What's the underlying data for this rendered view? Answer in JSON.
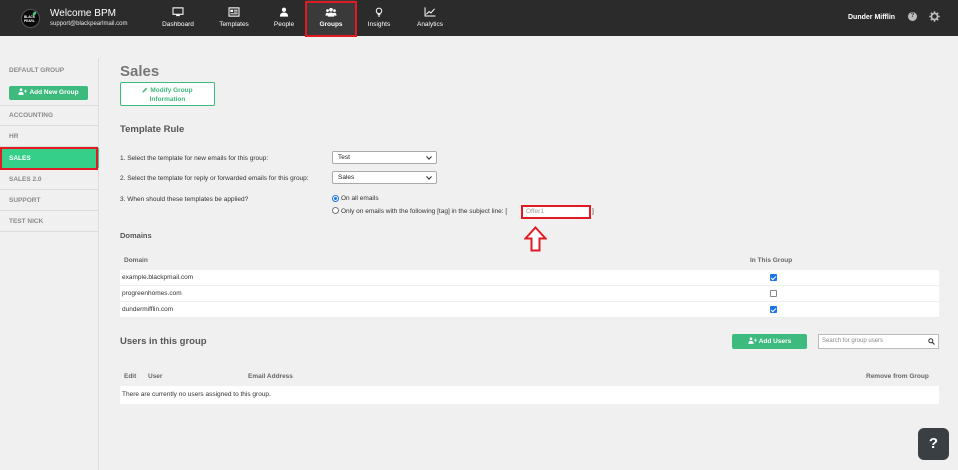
{
  "header": {
    "logo_line1": "BLACK",
    "logo_line2": "PEARL",
    "welcome": "Welcome BPM",
    "email": "support@blackpearlmail.com",
    "nav": [
      {
        "label": "Dashboard",
        "icon": "monitor-icon"
      },
      {
        "label": "Templates",
        "icon": "templates-icon"
      },
      {
        "label": "People",
        "icon": "person-icon"
      },
      {
        "label": "Groups",
        "icon": "group-icon",
        "active": true
      },
      {
        "label": "Insights",
        "icon": "lightbulb-icon"
      },
      {
        "label": "Analytics",
        "icon": "chart-icon"
      }
    ],
    "company": "Dunder Mifflin",
    "help_icon": "?",
    "settings_icon": "gear-icon"
  },
  "sidebar": {
    "default_group": "DEFAULT GROUP",
    "add_group_label": "Add New Group",
    "items": [
      "ACCOUNTING",
      "HR",
      "SALES",
      "SALES 2.0",
      "SUPPORT",
      "TEST NICK"
    ],
    "selected": "SALES",
    "accent": "#35cf8a"
  },
  "main": {
    "title": "Sales",
    "modify_line1": "Modify Group",
    "modify_line2": "Information",
    "template_rule": {
      "heading": "Template Rule",
      "q1": "1. Select the template for new emails for this group:",
      "q1_value": "Test",
      "q2": "2. Select the template for reply or forwarded emails for this group:",
      "q2_value": "Sales",
      "q3": "3. When should these templates be applied?",
      "opt_all": "On all emails",
      "opt_tag": "Only on emails with the following [tag] in the subject line: [",
      "tag_value": "Offer1",
      "tag_close": "]",
      "selected_option": "all"
    },
    "domains": {
      "heading": "Domains",
      "col_domain": "Domain",
      "col_in_group": "In This Group",
      "rows": [
        {
          "domain": "example.blackpmail.com",
          "in_group": true
        },
        {
          "domain": "progreenhomes.com",
          "in_group": false
        },
        {
          "domain": "dundermifflin.com",
          "in_group": true
        }
      ]
    },
    "users": {
      "heading": "Users in this group",
      "add_label": "Add Users",
      "search_placeholder": "Search for group users",
      "col_edit": "Edit",
      "col_user": "User",
      "col_email": "Email Address",
      "col_remove": "Remove from Group",
      "empty_text": "There are currently no users assigned to this group."
    }
  },
  "help_fab": "?",
  "colors": {
    "topbar": "#2b2b2b",
    "green": "#3dba7d",
    "highlight_red": "#e01b24"
  }
}
